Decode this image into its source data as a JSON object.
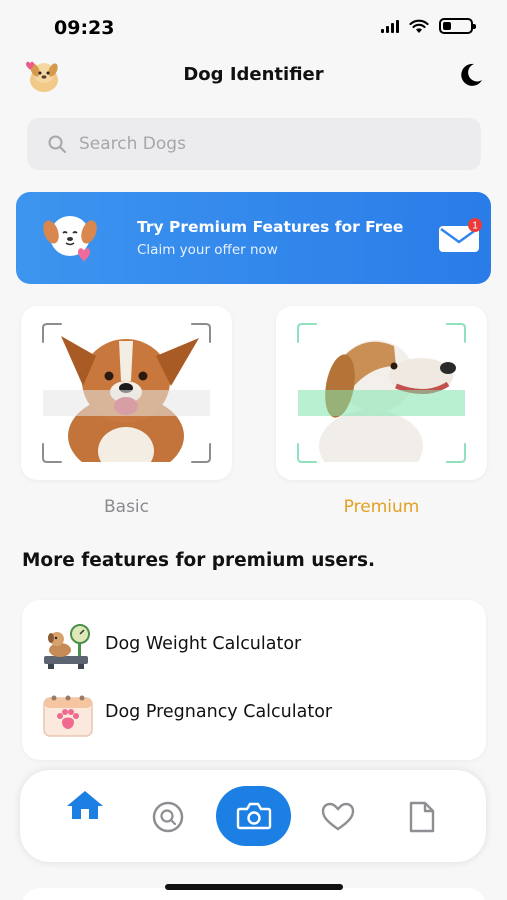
{
  "status": {
    "time": "09:23"
  },
  "header": {
    "title": "Dog Identifier"
  },
  "search": {
    "placeholder": "Search Dogs",
    "value": ""
  },
  "promo": {
    "title": "Try Premium Features for Free",
    "subtitle": "Claim your offer now",
    "badge_count": "1"
  },
  "modes": [
    {
      "label": "Basic"
    },
    {
      "label": "Premium"
    }
  ],
  "features": {
    "title": "More features for premium users.",
    "items": [
      {
        "label": "Dog Weight Calculator",
        "icon": "dog-scale-icon"
      },
      {
        "label": "Dog Pregnancy Calculator",
        "icon": "calendar-paw-icon"
      }
    ]
  },
  "tabbar": {
    "items": [
      "home-icon",
      "search-icon",
      "camera-icon",
      "heart-icon",
      "document-icon"
    ],
    "active": "home-icon"
  },
  "colors": {
    "accent": "#1c7fe3",
    "premium": "#e3a021",
    "promo": "#2f86ec"
  }
}
